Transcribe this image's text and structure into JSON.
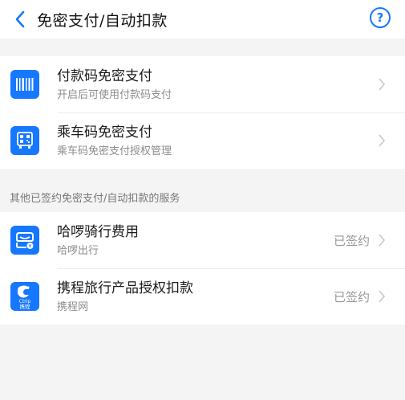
{
  "header": {
    "title": "免密支付/自动扣款",
    "help_symbol": "?"
  },
  "primary_items": [
    {
      "title": "付款码免密支付",
      "subtitle": "开启后可使用付款码支付",
      "icon": "barcode-icon"
    },
    {
      "title": "乘车码免密支付",
      "subtitle": "乘车码免密支付授权管理",
      "icon": "bus-qr-icon"
    }
  ],
  "section_label": "其他已签约免密支付/自动扣款的服务",
  "services": [
    {
      "title": "哈啰骑行费用",
      "subtitle": "哈啰出行",
      "status": "已签约",
      "icon": "hello-bike-icon"
    },
    {
      "title": "携程旅行产品授权扣款",
      "subtitle": "携程网",
      "status": "已签约",
      "icon": "ctrip-icon",
      "icon_text": {
        "top": "Ctrip",
        "bottom": "携程"
      }
    }
  ],
  "colors": {
    "accent": "#1677ff",
    "background": "#f4f4f4",
    "chevron": "#c8c8c8"
  }
}
